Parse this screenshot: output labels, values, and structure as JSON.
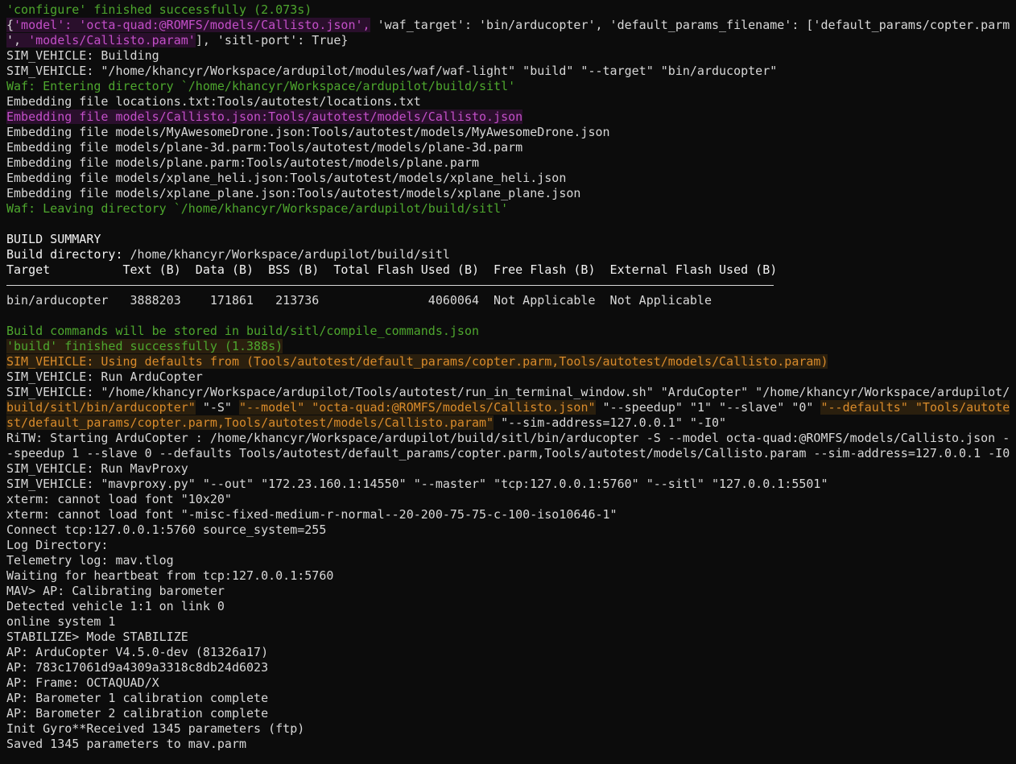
{
  "terminal": {
    "lines": [
      {
        "segments": [
          {
            "t": "'configure' finished successfully (2.073s)",
            "c": "green"
          }
        ]
      },
      {
        "segments": [
          {
            "t": "{",
            "c": "",
            "h": "hl-magenta"
          },
          {
            "t": "'model': 'octa-quad:@ROMFS/models/Callisto.json',",
            "c": "magenta",
            "h": "hl-magenta"
          },
          {
            "t": " 'waf_target': 'bin/arducopter', 'default_params_filename': ['default_params/copter.parm",
            "c": ""
          }
        ]
      },
      {
        "segments": [
          {
            "t": "', ",
            "c": "",
            "h": "hl-magenta"
          },
          {
            "t": "'models/Callisto.param'",
            "c": "magenta",
            "h": "hl-magenta"
          },
          {
            "t": "], 'sitl-port': True}",
            "c": ""
          }
        ]
      },
      {
        "segments": [
          {
            "t": "SIM_VEHICLE: Building",
            "c": ""
          }
        ]
      },
      {
        "segments": [
          {
            "t": "SIM_VEHICLE: \"/home/khancyr/Workspace/ardupilot/modules/waf/waf-light\" \"build\" \"--target\" \"bin/arducopter\"",
            "c": ""
          }
        ]
      },
      {
        "segments": [
          {
            "t": "Waf: Entering directory `/home/khancyr/Workspace/ardupilot/build/sitl'",
            "c": "green"
          }
        ]
      },
      {
        "segments": [
          {
            "t": "Embedding file locations.txt:Tools/autotest/locations.txt",
            "c": ""
          }
        ]
      },
      {
        "segments": [
          {
            "t": "Embedding file models/Callisto.json:Tools/autotest/models/Callisto.json",
            "c": "magenta",
            "h": "hl-magenta"
          }
        ]
      },
      {
        "segments": [
          {
            "t": "Embedding file models/MyAwesomeDrone.json:Tools/autotest/models/MyAwesomeDrone.json",
            "c": ""
          }
        ]
      },
      {
        "segments": [
          {
            "t": "Embedding file models/plane-3d.parm:Tools/autotest/models/plane-3d.parm",
            "c": ""
          }
        ]
      },
      {
        "segments": [
          {
            "t": "Embedding file models/plane.parm:Tools/autotest/models/plane.parm",
            "c": ""
          }
        ]
      },
      {
        "segments": [
          {
            "t": "Embedding file models/xplane_heli.json:Tools/autotest/models/xplane_heli.json",
            "c": ""
          }
        ]
      },
      {
        "segments": [
          {
            "t": "Embedding file models/xplane_plane.json:Tools/autotest/models/xplane_plane.json",
            "c": ""
          }
        ]
      },
      {
        "segments": [
          {
            "t": "Waf: Leaving directory `/home/khancyr/Workspace/ardupilot/build/sitl'",
            "c": "green"
          }
        ]
      },
      {
        "segments": [
          {
            "t": "",
            "c": ""
          }
        ]
      },
      {
        "segments": [
          {
            "t": "BUILD SUMMARY",
            "c": "white"
          }
        ]
      },
      {
        "segments": [
          {
            "t": "Build directory:",
            "c": "white"
          },
          {
            "t": " /home/khancyr/Workspace/ardupilot/build/sitl",
            "c": ""
          }
        ]
      },
      {
        "segments": [
          {
            "t": "Target          Text (B)  Data (B)  BSS (B)  Total Flash Used (B)  Free Flash (B)  External Flash Used (B)",
            "c": "white"
          }
        ]
      },
      {
        "rule": true,
        "segments": []
      },
      {
        "segments": [
          {
            "t": "bin/arducopter   3888203    171861   213736               4060064  Not Applicable  Not Applicable",
            "c": ""
          }
        ]
      },
      {
        "segments": [
          {
            "t": "",
            "c": ""
          }
        ]
      },
      {
        "segments": [
          {
            "t": "Build commands will be stored in build/sitl/compile_commands.json",
            "c": "green"
          }
        ]
      },
      {
        "segments": [
          {
            "t": "'build' finished successfully (1.388s)",
            "c": "green",
            "h": "hl-orange"
          }
        ]
      },
      {
        "segments": [
          {
            "t": "SIM_VEHICLE: Using defaults from (Tools/autotest/default_params/copter.parm,Tools/autotest/models/Callisto.param)",
            "c": "orange",
            "h": "hl-orange"
          }
        ]
      },
      {
        "segments": [
          {
            "t": "SIM_VEHICLE: Run ArduCopter",
            "c": ""
          }
        ]
      },
      {
        "segments": [
          {
            "t": "SIM_VEHICLE: \"/home/khancyr/Workspace/ardupilot/Tools/autotest/run_in_terminal_window.sh\" \"ArduCopter\" \"/home/khancyr/Workspace/ardupilot/",
            "c": ""
          }
        ]
      },
      {
        "segments": [
          {
            "t": "build/sitl/bin/arducopter\"",
            "c": "orange",
            "h": "hl-orange"
          },
          {
            "t": " \"-S\" ",
            "c": ""
          },
          {
            "t": "\"--model\" \"octa-quad:@ROMFS/models/Callisto.json\"",
            "c": "orange",
            "h": "hl-orange"
          },
          {
            "t": " \"--speedup\" \"1\" \"--slave\" \"0\" ",
            "c": ""
          },
          {
            "t": "\"--defaults\" \"Tools/autote",
            "c": "orange",
            "h": "hl-orange"
          }
        ]
      },
      {
        "segments": [
          {
            "t": "st/default_params/copter.parm,Tools/autotest/models/Callisto.param\"",
            "c": "orange",
            "h": "hl-orange"
          },
          {
            "t": " \"--sim-address=127.0.0.1\" \"-I0\"",
            "c": ""
          }
        ]
      },
      {
        "segments": [
          {
            "t": "RiTW: Starting ArduCopter : /home/khancyr/Workspace/ardupilot/build/sitl/bin/arducopter -S --model octa-quad:@ROMFS/models/Callisto.json -",
            "c": ""
          }
        ]
      },
      {
        "segments": [
          {
            "t": "-speedup 1 --slave 0 --defaults Tools/autotest/default_params/copter.parm,Tools/autotest/models/Callisto.param --sim-address=127.0.0.1 -I0",
            "c": ""
          }
        ]
      },
      {
        "segments": [
          {
            "t": "SIM_VEHICLE: Run MavProxy",
            "c": ""
          }
        ]
      },
      {
        "segments": [
          {
            "t": "SIM_VEHICLE: \"mavproxy.py\" \"--out\" \"172.23.160.1:14550\" \"--master\" \"tcp:127.0.0.1:5760\" \"--sitl\" \"127.0.0.1:5501\"",
            "c": ""
          }
        ]
      },
      {
        "segments": [
          {
            "t": "xterm: cannot load font \"10x20\"",
            "c": ""
          }
        ]
      },
      {
        "segments": [
          {
            "t": "xterm: cannot load font \"-misc-fixed-medium-r-normal--20-200-75-75-c-100-iso10646-1\"",
            "c": ""
          }
        ]
      },
      {
        "segments": [
          {
            "t": "Connect tcp:127.0.0.1:5760 source_system=255",
            "c": ""
          }
        ]
      },
      {
        "segments": [
          {
            "t": "Log Directory:",
            "c": ""
          }
        ]
      },
      {
        "segments": [
          {
            "t": "Telemetry log: mav.tlog",
            "c": ""
          }
        ]
      },
      {
        "segments": [
          {
            "t": "Waiting for heartbeat from tcp:127.0.0.1:5760",
            "c": ""
          }
        ]
      },
      {
        "segments": [
          {
            "t": "MAV> AP: Calibrating barometer",
            "c": ""
          }
        ]
      },
      {
        "segments": [
          {
            "t": "Detected vehicle 1:1 on link 0",
            "c": ""
          }
        ]
      },
      {
        "segments": [
          {
            "t": "online system 1",
            "c": ""
          }
        ]
      },
      {
        "segments": [
          {
            "t": "STABILIZE> Mode STABILIZE",
            "c": ""
          }
        ]
      },
      {
        "segments": [
          {
            "t": "AP: ArduCopter V4.5.0-dev (81326a17)",
            "c": ""
          }
        ]
      },
      {
        "segments": [
          {
            "t": "AP: 783c17061d9a4309a3318c8db24d6023",
            "c": ""
          }
        ]
      },
      {
        "segments": [
          {
            "t": "AP: Frame: OCTAQUAD/X",
            "c": ""
          }
        ]
      },
      {
        "segments": [
          {
            "t": "AP: Barometer 1 calibration complete",
            "c": ""
          }
        ]
      },
      {
        "segments": [
          {
            "t": "AP: Barometer 2 calibration complete",
            "c": ""
          }
        ]
      },
      {
        "segments": [
          {
            "t": "Init Gyro**Received 1345 parameters (ftp)",
            "c": ""
          }
        ]
      },
      {
        "segments": [
          {
            "t": "Saved 1345 parameters to mav.parm",
            "c": ""
          }
        ]
      }
    ]
  }
}
